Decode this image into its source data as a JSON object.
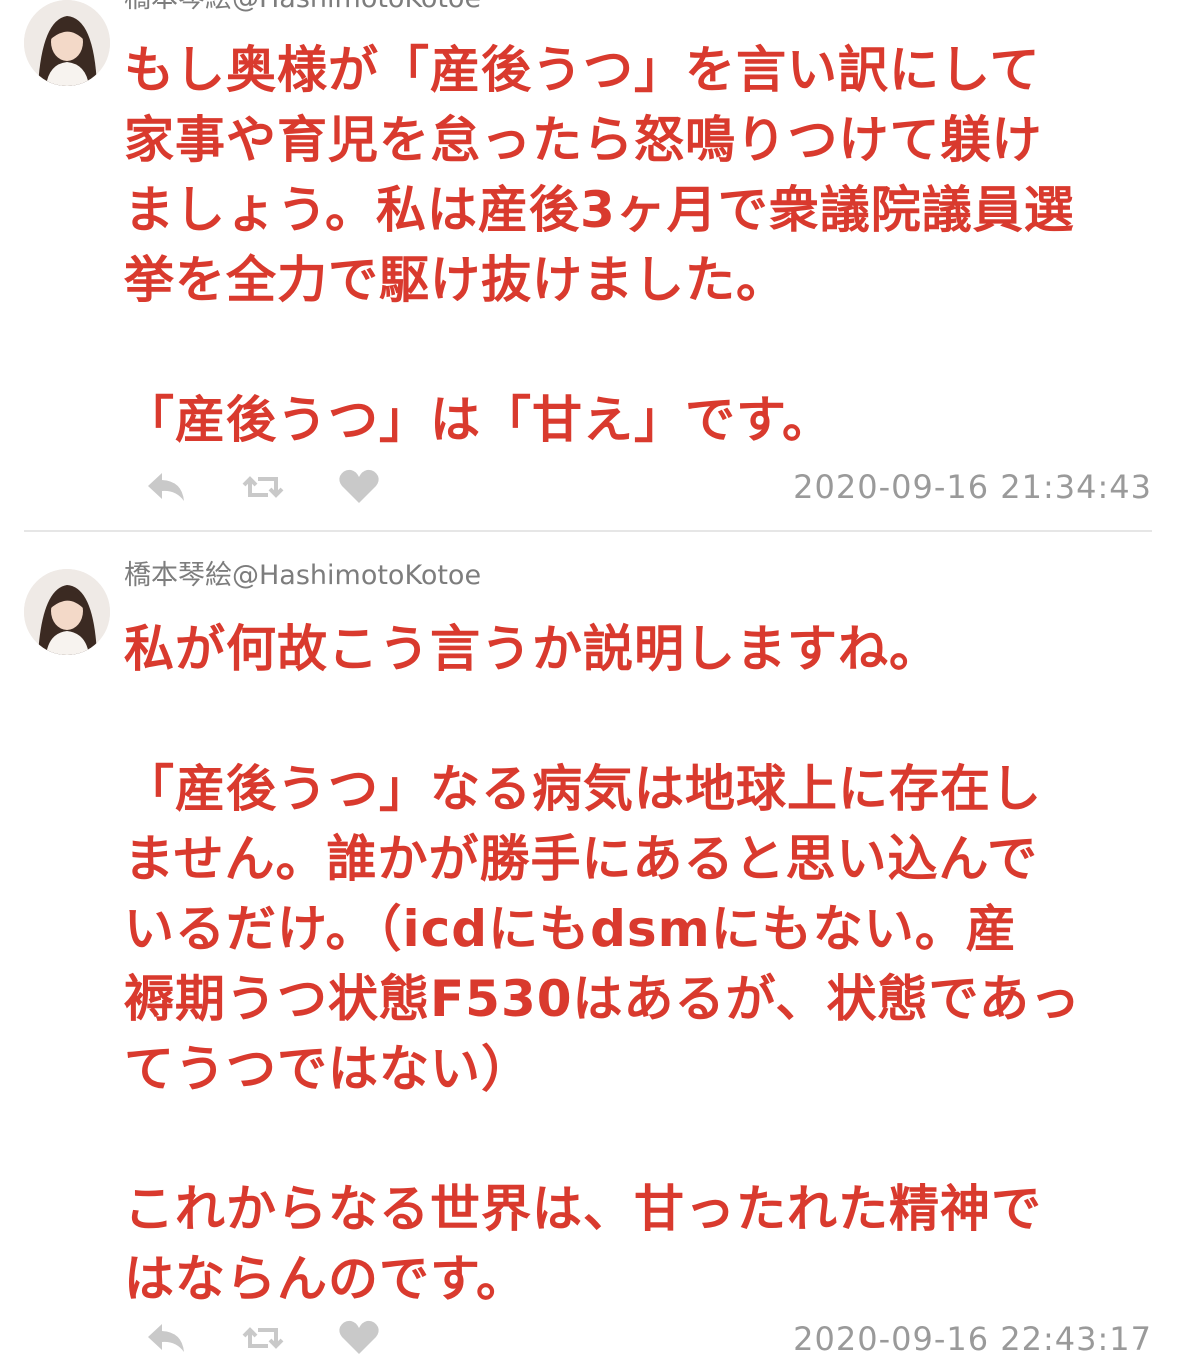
{
  "tweets": [
    {
      "author": "橋本琴絵@HashimotoKotoe",
      "lines": [
        "もし奥様が「産後うつ」を言い訳にして",
        "家事や育児を怠ったら怒鳴りつけて躾け",
        "ましょう。私は産後3ヶ月で衆議院議員選",
        "挙を全力で駆け抜けました。",
        "",
        "「産後うつ」は「甘え」です。"
      ],
      "timestamp": "2020-09-16 21:34:43",
      "icons": [
        "reply-icon",
        "retweet-icon",
        "like-icon"
      ]
    },
    {
      "author": "橋本琴絵@HashimotoKotoe",
      "lines": [
        "私が何故こう言うか説明しますね。",
        "",
        "「産後うつ」なる病気は地球上に存在し",
        "ません。誰かが勝手にあると思い込んで",
        "いるだけ。（icdにもdsmにもない。産",
        "褥期うつ状態F530はあるが、状態であっ",
        "てうつではない）",
        "",
        "これからなる世界は、甘ったれた精神で",
        "はならんのです。"
      ],
      "timestamp": "2020-09-16 22:43:17",
      "icons": [
        "reply-icon",
        "retweet-icon",
        "like-icon"
      ]
    }
  ],
  "colors": {
    "body_text": "#d93a2e",
    "meta_text": "#9a9a9a",
    "icon": "#c9c9c9",
    "divider": "#e6e6e6"
  }
}
